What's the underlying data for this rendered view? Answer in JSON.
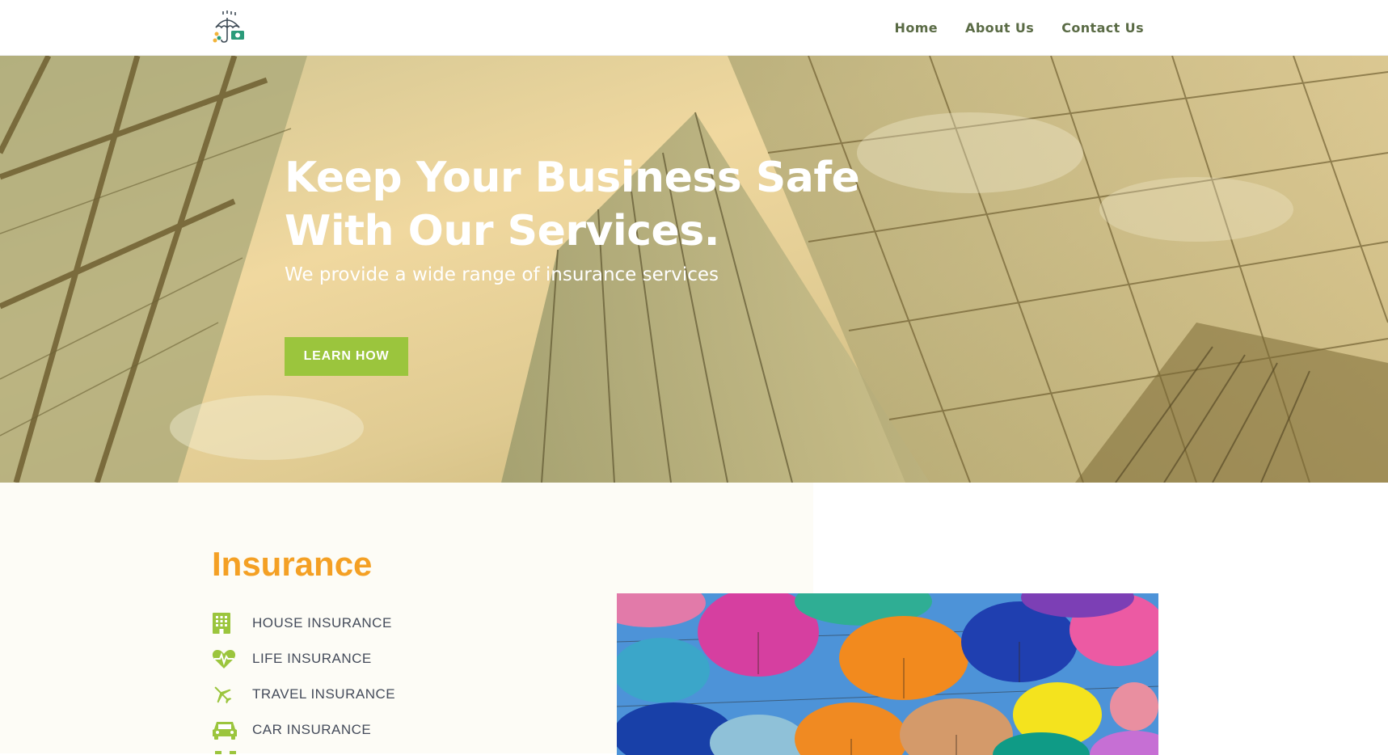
{
  "header": {
    "nav": [
      {
        "label": "Home"
      },
      {
        "label": "About Us"
      },
      {
        "label": "Contact Us"
      }
    ]
  },
  "hero": {
    "title_line1": "Keep Your Business Safe",
    "title_line2": "With Our Services.",
    "subtitle": "We provide a wide range of insurance services",
    "cta_label": "LEARN HOW"
  },
  "insurance": {
    "title": "Insurance",
    "items": [
      {
        "label": "HOUSE INSURANCE",
        "icon": "building-icon"
      },
      {
        "label": "LIFE INSURANCE",
        "icon": "heart-pulse-icon"
      },
      {
        "label": "TRAVEL INSURANCE",
        "icon": "airplane-icon"
      },
      {
        "label": "CAR INSURANCE",
        "icon": "car-icon"
      }
    ]
  },
  "colors": {
    "accent_green": "#9bc53d",
    "accent_orange": "#f4a024",
    "nav_text": "#5a6b45"
  }
}
